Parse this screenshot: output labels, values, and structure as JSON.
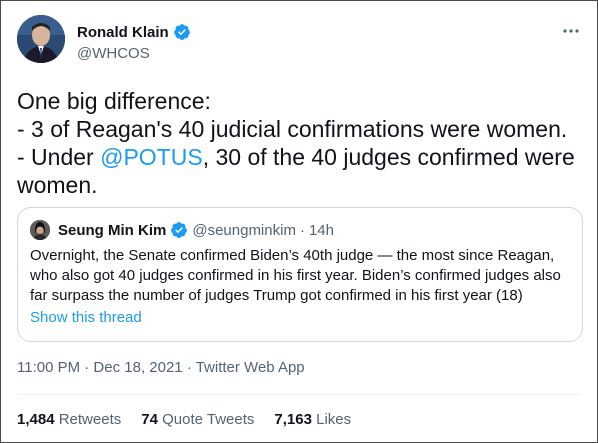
{
  "author": {
    "display_name": "Ronald Klain",
    "handle": "@WHCOS"
  },
  "tweet": {
    "line1": "One big difference:",
    "line2": "- 3 of Reagan's 40 judicial confirmations were women.",
    "line3_prefix": "- Under ",
    "mention": "@POTUS",
    "line3_suffix": ", 30 of the 40 judges confirmed were women."
  },
  "quote": {
    "display_name": "Seung Min Kim",
    "handle": "@seungminkim",
    "separator": "·",
    "time": "14h",
    "text": "Overnight, the Senate confirmed Biden’s 40th judge — the most since Reagan, who also got 40 judges confirmed in his first year. Biden’s confirmed judges also far surpass the number of judges Trump got confirmed in his first year (18)",
    "show_thread": "Show this thread"
  },
  "meta": {
    "timestamp": "11:00 PM · Dec 18, 2021 · Twitter Web App"
  },
  "stats": {
    "retweets_count": "1,484",
    "retweets_label": "Retweets",
    "quotes_count": "74",
    "quotes_label": "Quote Tweets",
    "likes_count": "7,163",
    "likes_label": "Likes"
  },
  "icons": {
    "more": "more-horizontal-icon",
    "verified": "verified-badge-icon"
  },
  "colors": {
    "link": "#1d9bf0",
    "secondary_text": "#536471",
    "primary_text": "#0f1419"
  }
}
